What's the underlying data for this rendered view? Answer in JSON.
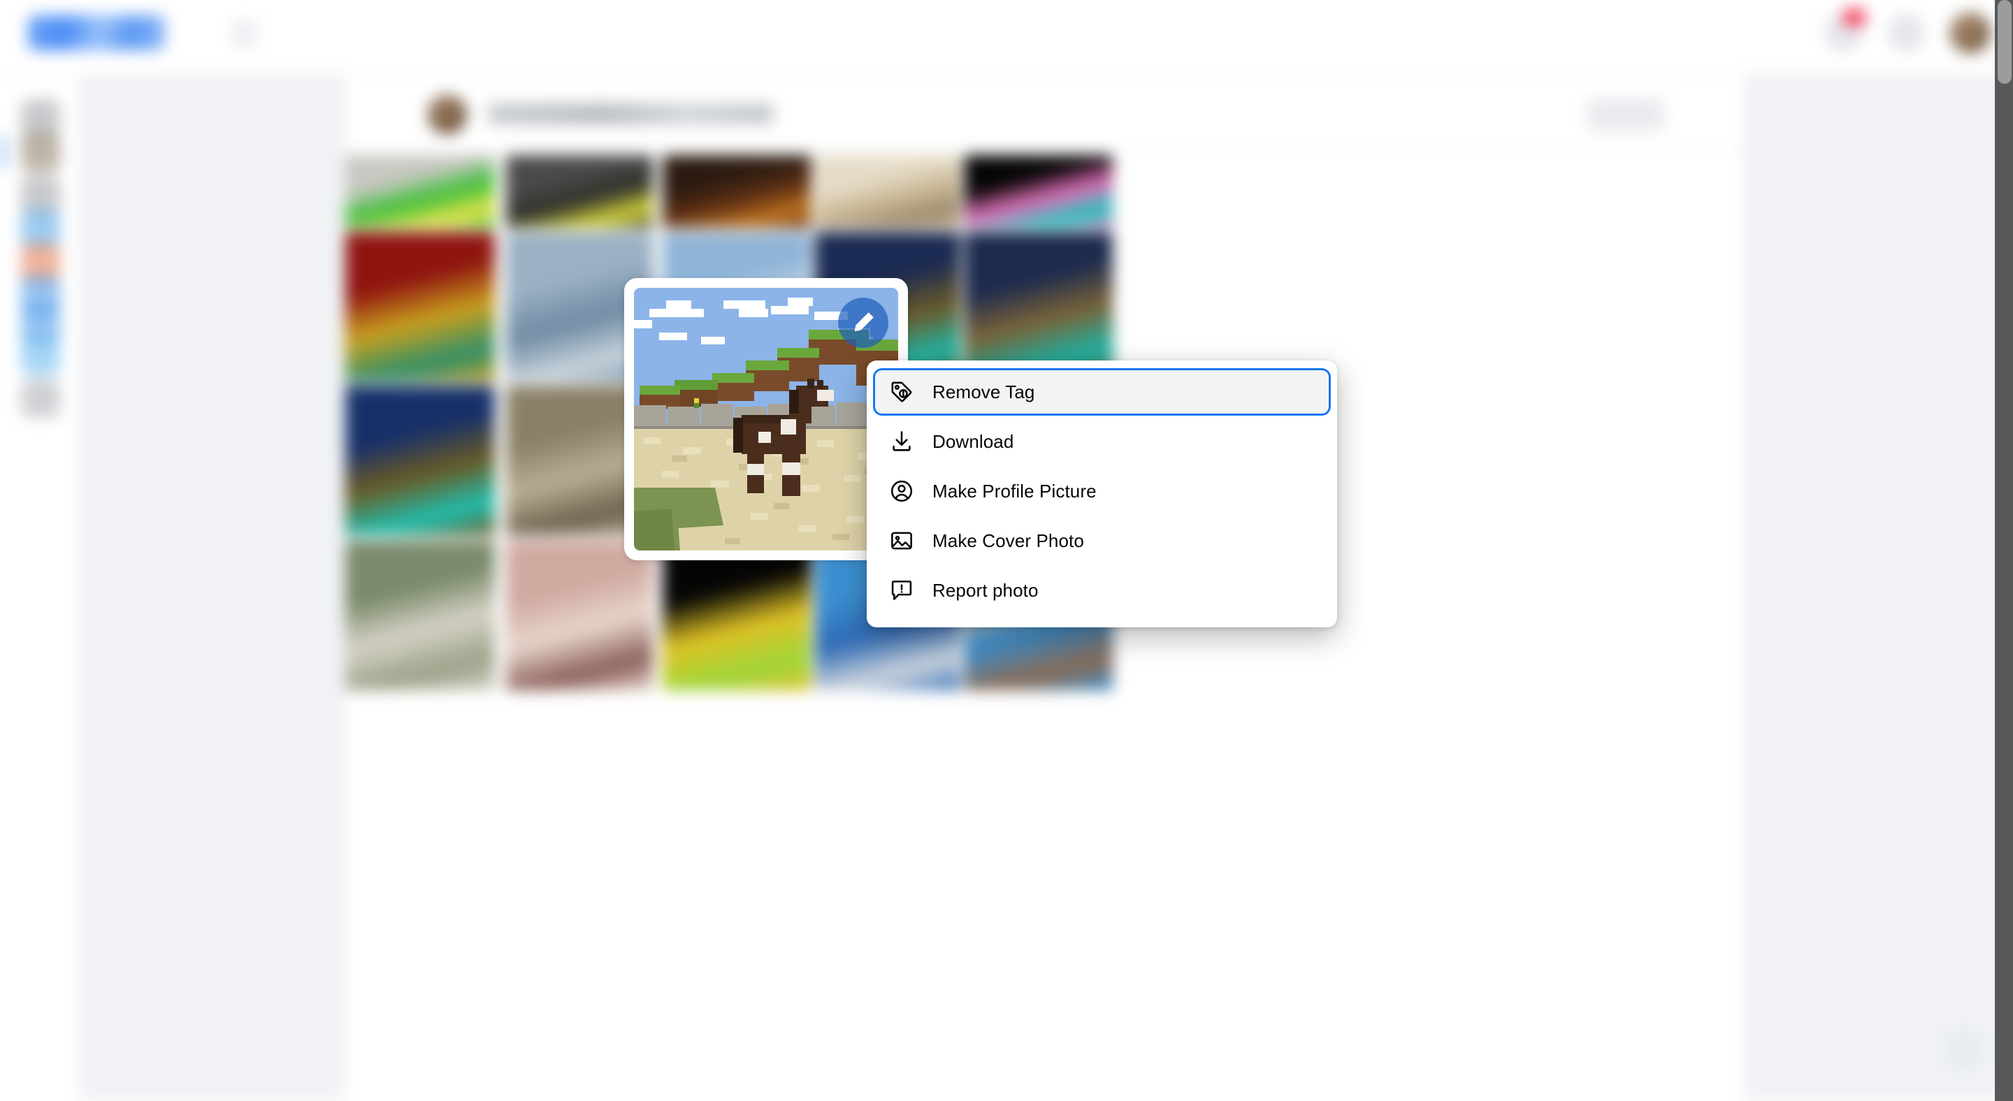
{
  "app": {
    "brand_name": "facebook",
    "background_color": "#f0f2f5",
    "accent_color": "#1877f2",
    "badge_color": "#f3425f"
  },
  "topbar": {
    "brand_label": "",
    "grid_toggle_label": "",
    "icons": [
      {
        "name": "messenger-icon",
        "badge": ""
      },
      {
        "name": "notifications-icon",
        "badge": ""
      },
      {
        "name": "account-avatar",
        "badge": ""
      }
    ]
  },
  "sidebar": {
    "active_index": 1,
    "items": [
      {
        "name": "sidebar-item-1",
        "label": "",
        "color": "#9a9da2"
      },
      {
        "name": "sidebar-item-2",
        "label": "",
        "color": "#8a7a62"
      },
      {
        "name": "sidebar-item-3",
        "label": "",
        "color": "#9a9da2"
      },
      {
        "name": "sidebar-item-4",
        "label": "",
        "color": "#4da3e8"
      },
      {
        "name": "sidebar-item-5",
        "label": "",
        "color": "#e8764a"
      },
      {
        "name": "sidebar-item-6",
        "label": "",
        "color": "#3f93e8"
      },
      {
        "name": "sidebar-item-7",
        "label": "",
        "color": "#3f93e8"
      },
      {
        "name": "sidebar-item-8",
        "label": "",
        "color": "#5cb4ee"
      },
      {
        "name": "sidebar-item-9",
        "label": "",
        "color": "#a8abb0"
      }
    ]
  },
  "header": {
    "profile_name": "",
    "action_label": ""
  },
  "photo_grid": {
    "columns": 5,
    "rows": 4,
    "selected": {
      "name": "minecraft-horse-photo",
      "description": "Minecraft horse on sand beside grass-topped hill",
      "edit_badge_icon": "pencil-icon"
    },
    "thumbnails": [
      {
        "id": "t1",
        "c1": "#c9c7c2",
        "c2": "#3fbf3b",
        "c3": "#e9e54a"
      },
      {
        "id": "t2",
        "c1": "#4a4a48",
        "c2": "#2f2f2d",
        "c3": "#d8d83c"
      },
      {
        "id": "t3",
        "c1": "#2a1a10",
        "c2": "#5e2f14",
        "c3": "#c4761f"
      },
      {
        "id": "t4",
        "c1": "#e6dcc8",
        "c2": "#c9b896",
        "c3": "#9a8a6a"
      },
      {
        "id": "t5",
        "c1": "#050505",
        "c2": "#e26fb8",
        "c3": "#1fc8c0"
      },
      {
        "id": "t6",
        "c1": "#8f1410",
        "c2": "#c9a01e",
        "c3": "#2f8f6a"
      },
      {
        "id": "t7",
        "c1": "#9bb0c4",
        "c2": "#6f8ba3",
        "c3": "#c9d4dd"
      },
      {
        "id": "t8",
        "c1": "#8fb4d8",
        "c2": "#e3e8ec",
        "c3": "#d6c27a"
      },
      {
        "id": "t9",
        "c1": "#1a2a52",
        "c2": "#6b5a2a",
        "c3": "#1fb8a8"
      },
      {
        "id": "t10",
        "c1": "#1c2a4e",
        "c2": "#7a6338",
        "c3": "#1bb4a6"
      },
      {
        "id": "t11",
        "c1": "#17306a",
        "c2": "#6a5a24",
        "c3": "#1fc0b0"
      },
      {
        "id": "t12",
        "c1": "#8a8068",
        "c2": "#b9ae92",
        "c3": "#6d6450"
      },
      {
        "id": "t13",
        "c1": "#4a3a30",
        "c2": "#8e2a2a",
        "c3": "#c9c4bd"
      },
      {
        "id": "t14",
        "c1": "#c9c2b4",
        "c2": "#8e8376",
        "c3": "#ece7dd"
      },
      {
        "id": "t15",
        "c1": "#7e6a48",
        "c2": "#c9b87e",
        "c3": "#4c4030"
      },
      {
        "id": "t16",
        "c1": "#7a8a6a",
        "c2": "#d6d2c6",
        "c3": "#9aa288"
      },
      {
        "id": "t17",
        "c1": "#cfa9a0",
        "c2": "#e8d6cc",
        "c3": "#8a5f58"
      },
      {
        "id": "t18",
        "c1": "#050505",
        "c2": "#e0c225",
        "c3": "#9ed63a"
      },
      {
        "id": "t19",
        "c1": "#3b8fd0",
        "c2": "#2f6ab5",
        "c3": "#cfd6dd"
      },
      {
        "id": "t20",
        "c1": "#e6e2d8",
        "c2": "#3b8fd0",
        "c3": "#8a6a52"
      }
    ]
  },
  "context_menu": {
    "items": [
      {
        "name": "remove-tag",
        "label": "Remove Tag",
        "icon": "tag-icon",
        "focused": true
      },
      {
        "name": "download",
        "label": "Download",
        "icon": "download-icon",
        "focused": false
      },
      {
        "name": "make-profile-picture",
        "label": "Make Profile Picture",
        "icon": "user-circle-icon",
        "focused": false
      },
      {
        "name": "make-cover-photo",
        "label": "Make Cover Photo",
        "icon": "image-icon",
        "focused": false
      },
      {
        "name": "report-photo",
        "label": "Report photo",
        "icon": "report-icon",
        "focused": false
      }
    ]
  }
}
